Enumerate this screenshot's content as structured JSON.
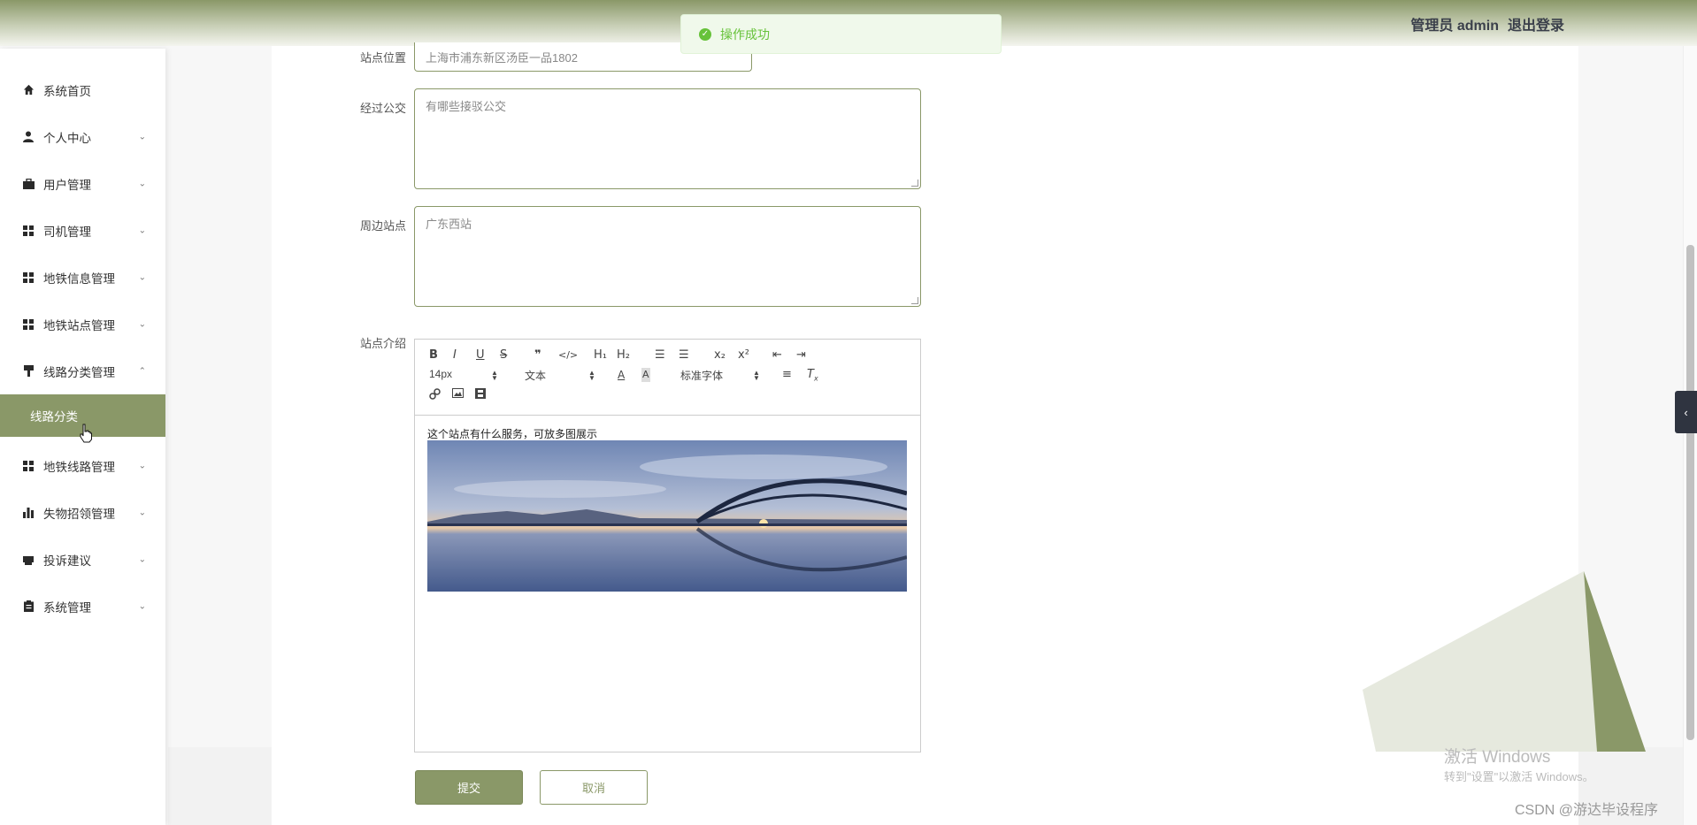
{
  "header": {
    "user_label": "管理员 admin",
    "logout_label": "退出登录"
  },
  "toast": {
    "message": "操作成功"
  },
  "sidebar": {
    "items": [
      {
        "label": "系统首页",
        "icon": "home-icon",
        "has_arrow": false
      },
      {
        "label": "个人中心",
        "icon": "user-icon",
        "has_arrow": true
      },
      {
        "label": "用户管理",
        "icon": "briefcase-icon",
        "has_arrow": true
      },
      {
        "label": "司机管理",
        "icon": "grid-icon",
        "has_arrow": true
      },
      {
        "label": "地铁信息管理",
        "icon": "grid-icon",
        "has_arrow": true
      },
      {
        "label": "地铁站点管理",
        "icon": "grid-icon",
        "has_arrow": true
      },
      {
        "label": "线路分类管理",
        "icon": "brush-icon",
        "has_arrow": true,
        "expanded": true
      },
      {
        "label": "地铁线路管理",
        "icon": "grid-icon",
        "has_arrow": true
      },
      {
        "label": "失物招领管理",
        "icon": "bar-chart-icon",
        "has_arrow": true
      },
      {
        "label": "投诉建议",
        "icon": "printer-icon",
        "has_arrow": true
      },
      {
        "label": "系统管理",
        "icon": "clipboard-icon",
        "has_arrow": true
      }
    ],
    "sub_item": {
      "label": "线路分类"
    }
  },
  "form": {
    "location_label": "站点位置",
    "location_value": "上海市浦东新区汤臣一品1802",
    "bus_label": "经过公交",
    "bus_placeholder": "有哪些接驳公交",
    "nearby_label": "周边站点",
    "nearby_value": "广东西站",
    "intro_label": "站点介绍",
    "intro_text": "这个站点有什么服务，可放多图展示",
    "submit_label": "提交",
    "cancel_label": "取消"
  },
  "editor": {
    "font_size": "14px",
    "block_format": "文本",
    "font_family": "标准字体",
    "h1": "H₁",
    "h2": "H₂"
  },
  "watermark": {
    "line1": "激活 Windows",
    "line2": "转到\"设置\"以激活 Windows。"
  },
  "credit": "CSDN @游达毕设程序",
  "colors": {
    "accent": "#8a9868",
    "success": "#67c23a"
  }
}
